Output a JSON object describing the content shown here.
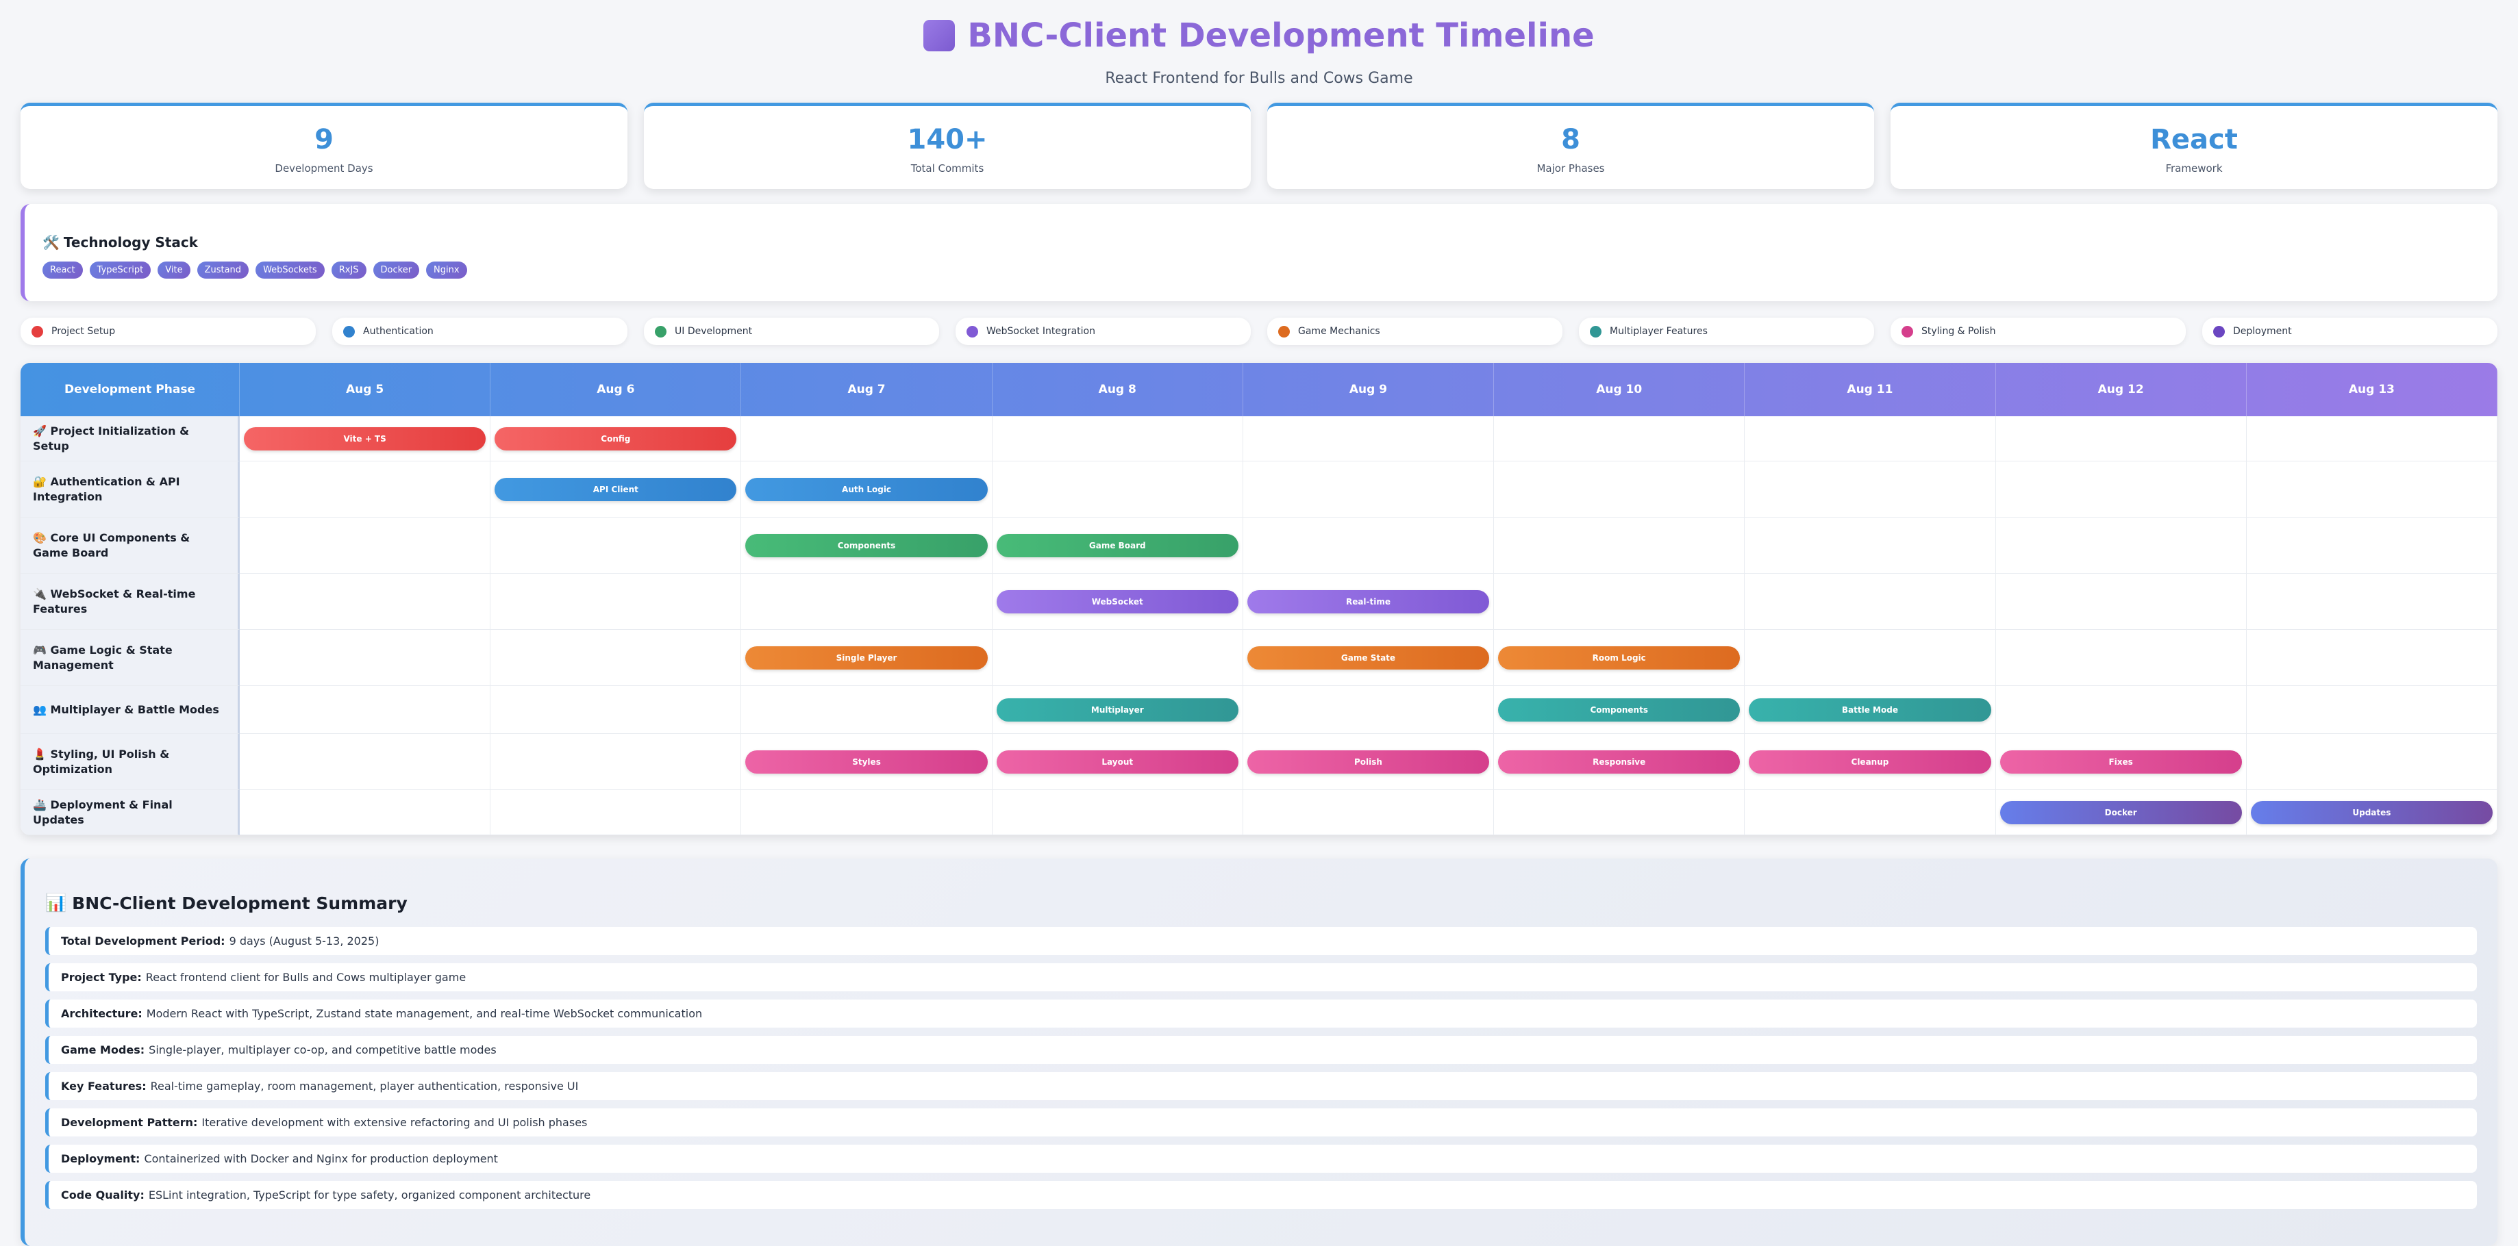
{
  "header": {
    "title": "BNC-Client Development Timeline",
    "subtitle": "React Frontend for Bulls and Cows Game"
  },
  "stats": [
    {
      "value": "9",
      "label": "Development Days"
    },
    {
      "value": "140+",
      "label": "Total Commits"
    },
    {
      "value": "8",
      "label": "Major Phases"
    },
    {
      "value": "React",
      "label": "Framework"
    }
  ],
  "tech": {
    "icon": "🛠️",
    "title": "Technology Stack",
    "tags": [
      "React",
      "TypeScript",
      "Vite",
      "Zustand",
      "WebSockets",
      "RxJS",
      "Docker",
      "Nginx"
    ]
  },
  "legend": [
    {
      "label": "Project Setup",
      "color": "#e53e3e"
    },
    {
      "label": "Authentication",
      "color": "#3182ce"
    },
    {
      "label": "UI Development",
      "color": "#38a169"
    },
    {
      "label": "WebSocket Integration",
      "color": "#805ad5"
    },
    {
      "label": "Game Mechanics",
      "color": "#dd6b20"
    },
    {
      "label": "Multiplayer Features",
      "color": "#319795"
    },
    {
      "label": "Styling & Polish",
      "color": "#d53f8c"
    },
    {
      "label": "Deployment",
      "color": "#6b46c1"
    }
  ],
  "timeline": {
    "phase_header": "Development Phase",
    "days": [
      "Aug 5",
      "Aug 6",
      "Aug 7",
      "Aug 8",
      "Aug 9",
      "Aug 10",
      "Aug 11",
      "Aug 12",
      "Aug 13"
    ],
    "rows": [
      {
        "phase": "🚀 Project Initialization & Setup",
        "gradient": [
          "#f56565",
          "#e53e3e"
        ],
        "cells": [
          "Vite + TS",
          "Config",
          "",
          "",
          "",
          "",
          "",
          "",
          ""
        ]
      },
      {
        "phase": "🔐 Authentication & API Integration",
        "gradient": [
          "#4299e1",
          "#3182ce"
        ],
        "cells": [
          "",
          "API Client",
          "Auth Logic",
          "",
          "",
          "",
          "",
          "",
          ""
        ]
      },
      {
        "phase": "🎨 Core UI Components & Game Board",
        "gradient": [
          "#48bb78",
          "#38a169"
        ],
        "cells": [
          "",
          "",
          "Components",
          "Game Board",
          "",
          "",
          "",
          "",
          ""
        ]
      },
      {
        "phase": "🔌 WebSocket & Real-time Features",
        "gradient": [
          "#9f7aea",
          "#805ad5"
        ],
        "cells": [
          "",
          "",
          "",
          "WebSocket",
          "Real-time",
          "",
          "",
          "",
          ""
        ]
      },
      {
        "phase": "🎮 Game Logic & State Management",
        "gradient": [
          "#ed8936",
          "#dd6b20"
        ],
        "cells": [
          "",
          "",
          "Single Player",
          "",
          "Game State",
          "Room Logic",
          "",
          "",
          ""
        ]
      },
      {
        "phase": "👥 Multiplayer & Battle Modes",
        "gradient": [
          "#38b2ac",
          "#319795"
        ],
        "cells": [
          "",
          "",
          "",
          "Multiplayer",
          "",
          "Components",
          "Battle Mode",
          "",
          ""
        ]
      },
      {
        "phase": "💄 Styling, UI Polish & Optimization",
        "gradient": [
          "#ed64a6",
          "#d53f8c"
        ],
        "cells": [
          "",
          "",
          "Styles",
          "Layout",
          "Polish",
          "Responsive",
          "Cleanup",
          "Fixes",
          ""
        ]
      },
      {
        "phase": "🚢 Deployment & Final Updates",
        "gradient": [
          "#667eea",
          "#764ba2"
        ],
        "cells": [
          "",
          "",
          "",
          "",
          "",
          "",
          "",
          "Docker",
          "Updates"
        ]
      }
    ]
  },
  "summary": {
    "icon": "📊",
    "title": "BNC-Client Development Summary",
    "items": [
      {
        "label": "Total Development Period:",
        "text": "9 days (August 5-13, 2025)"
      },
      {
        "label": "Project Type:",
        "text": "React frontend client for Bulls and Cows multiplayer game"
      },
      {
        "label": "Architecture:",
        "text": "Modern React with TypeScript, Zustand state management, and real-time WebSocket communication"
      },
      {
        "label": "Game Modes:",
        "text": "Single-player, multiplayer co-op, and competitive battle modes"
      },
      {
        "label": "Key Features:",
        "text": "Real-time gameplay, room management, player authentication, responsive UI"
      },
      {
        "label": "Development Pattern:",
        "text": "Iterative development with extensive refactoring and UI polish phases"
      },
      {
        "label": "Deployment:",
        "text": "Containerized with Docker and Nginx for production deployment"
      },
      {
        "label": "Code Quality:",
        "text": "ESLint integration, TypeScript for type safety, organized component architecture"
      }
    ]
  }
}
